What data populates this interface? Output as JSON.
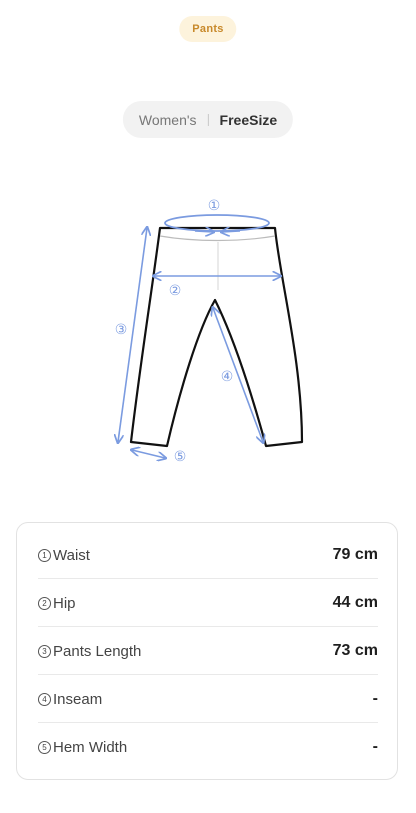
{
  "product": {
    "category": "Pants"
  },
  "size_selector": {
    "gender": "Women's",
    "size": "FreeSize"
  },
  "diagram": {
    "markers": [
      "①",
      "②",
      "③",
      "④",
      "⑤"
    ],
    "colors": {
      "measure_line": "#7b9be0",
      "outline": "#111111"
    }
  },
  "measurements": [
    {
      "number": "1",
      "label": "Waist",
      "value": "79 cm"
    },
    {
      "number": "2",
      "label": "Hip",
      "value": "44 cm"
    },
    {
      "number": "3",
      "label": "Pants Length",
      "value": "73 cm"
    },
    {
      "number": "4",
      "label": "Inseam",
      "value": "-"
    },
    {
      "number": "5",
      "label": "Hem Width",
      "value": "-"
    }
  ],
  "colors": {
    "badge_bg": "#fdf3dc",
    "badge_text": "#c8892a"
  }
}
